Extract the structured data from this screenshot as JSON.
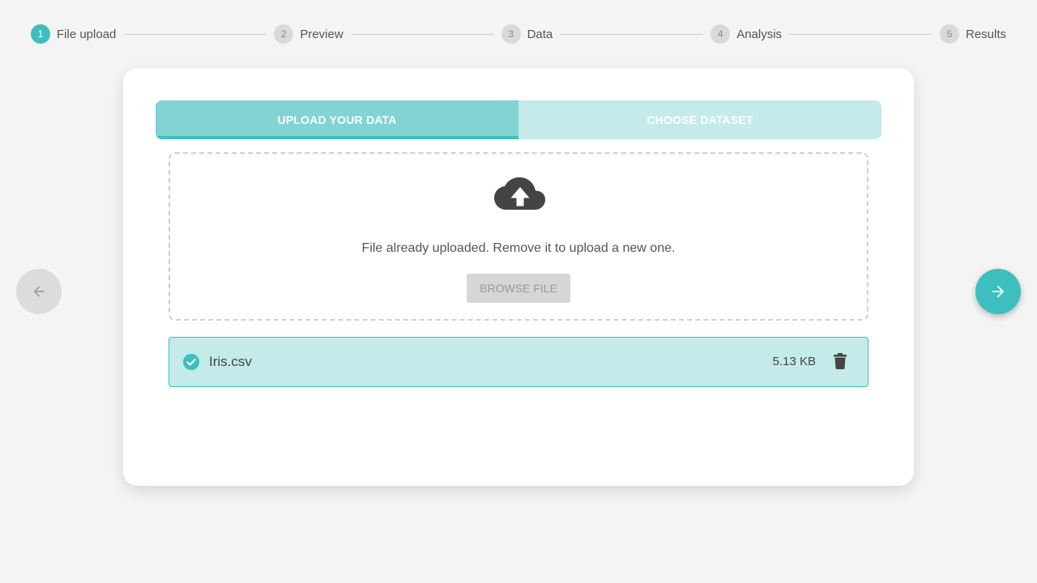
{
  "stepper": {
    "steps": [
      {
        "num": "1",
        "label": "File upload"
      },
      {
        "num": "2",
        "label": "Preview"
      },
      {
        "num": "3",
        "label": "Data"
      },
      {
        "num": "4",
        "label": "Analysis"
      },
      {
        "num": "5",
        "label": "Results"
      }
    ],
    "active_step": 1
  },
  "tabs": {
    "upload": "UPLOAD YOUR DATA",
    "choose": "CHOOSE DATASET"
  },
  "dropzone": {
    "icon": "cloud-upload-icon",
    "message": "File already uploaded. Remove it to upload a new one.",
    "browse_label": "BROWSE FILE"
  },
  "file": {
    "name": "Iris.csv",
    "size": "5.13 KB",
    "status_icon": "check-circle-icon",
    "delete_icon": "trash-icon"
  },
  "nav": {
    "prev_icon": "arrow-left-icon",
    "next_icon": "arrow-right-icon"
  },
  "colors": {
    "accent": "#3dbfbf",
    "tab_active": "#82d3d3",
    "tab_inactive": "#c5eaea",
    "icon_dark": "#444444"
  }
}
